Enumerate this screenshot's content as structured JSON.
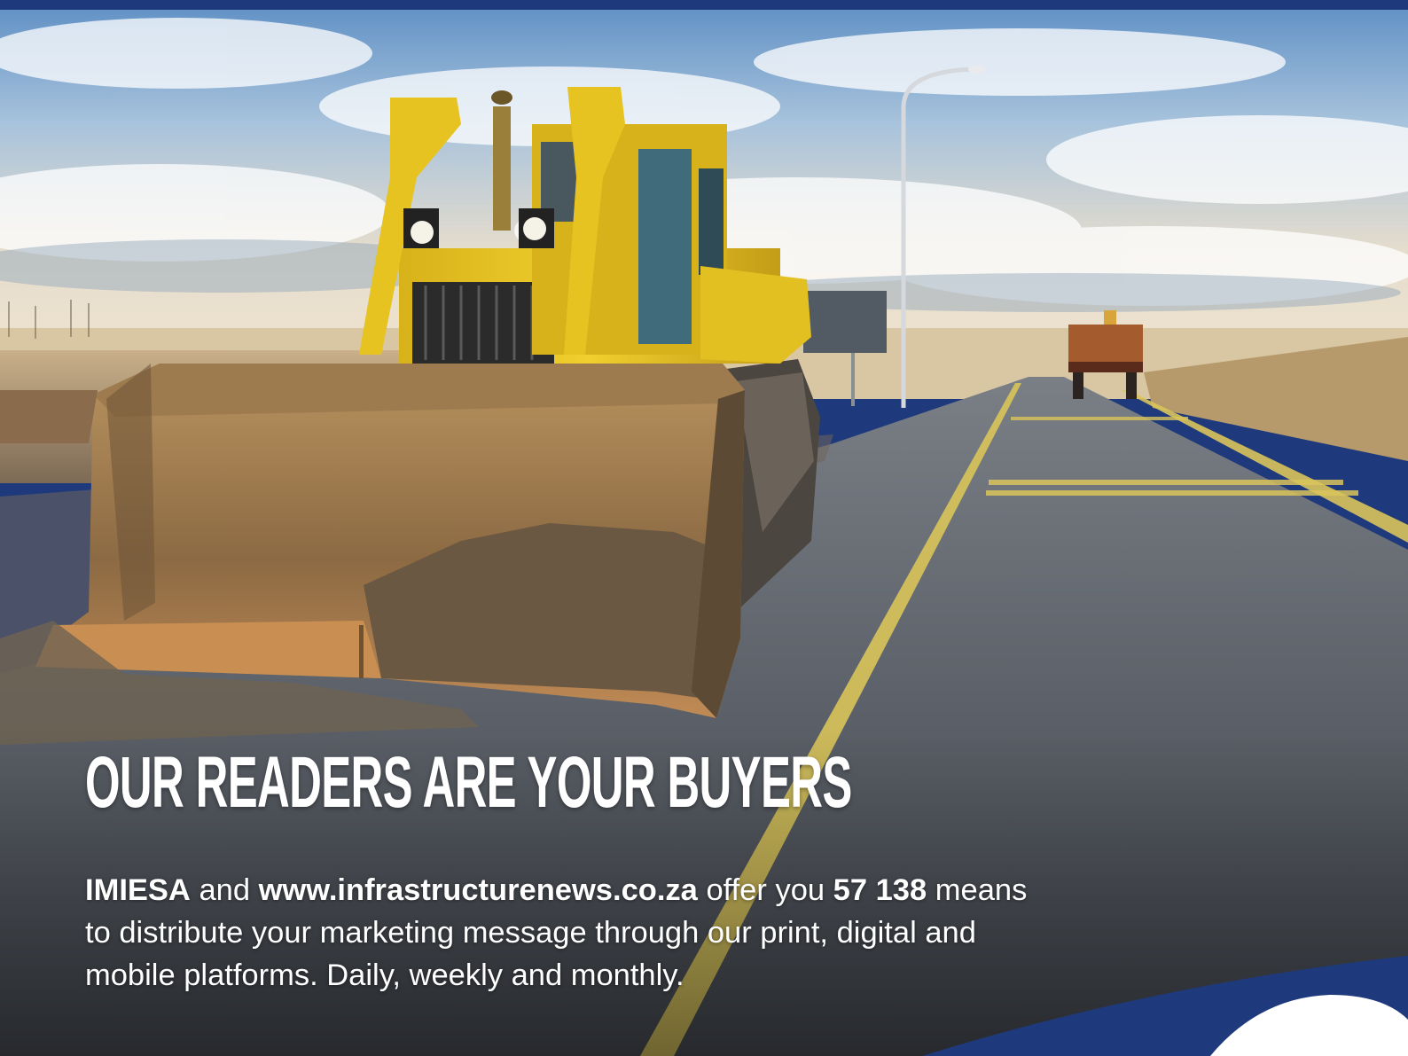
{
  "headline": "OUR READERS ARE YOUR BUYERS",
  "intro": {
    "brand": "IMIESA",
    "and": " and ",
    "website": "www.infrastructurenews.co.za",
    "offer": " offer you ",
    "count": "57 138",
    "rest_line1": " means",
    "line2": "to distribute your marketing message through our print, digital and",
    "line3": "mobile platforms. Daily, weekly and monthly."
  },
  "colors": {
    "brand_blue": "#1f3a7c",
    "machine_yellow": "#e8c21c",
    "road_line": "#d9c45a"
  },
  "photo": {
    "subject": "bulldozer-on-road"
  }
}
